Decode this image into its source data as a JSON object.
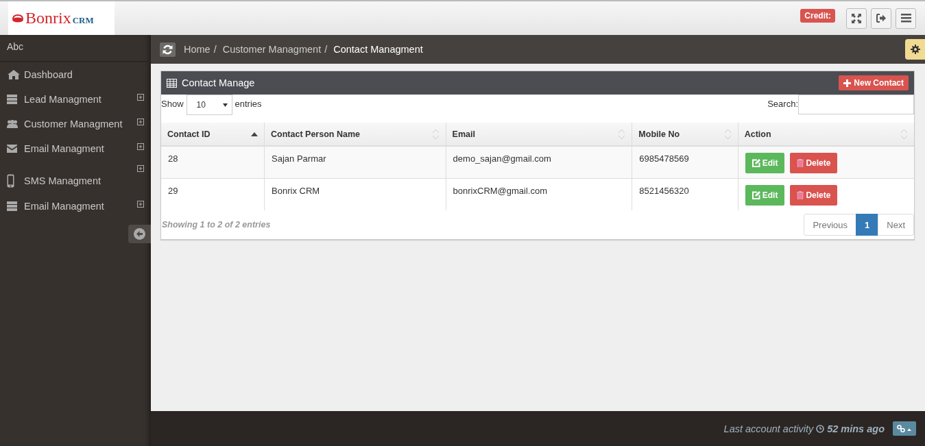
{
  "header": {
    "logo": {
      "brand": "Bonrix",
      "suffix": "CRM"
    },
    "credit": "Credit:"
  },
  "sidebar": {
    "user": "Abc",
    "items": [
      {
        "label": "Dashboard",
        "kind": "home",
        "expandable": false
      },
      {
        "label": "Lead Managment",
        "kind": "server",
        "expandable": true
      },
      {
        "label": "Customer Managment",
        "kind": "users",
        "expandable": true
      },
      {
        "label": "Email Managment",
        "kind": "envelope",
        "expandable": true
      },
      {
        "label": "SMS Managment",
        "kind": "mobile",
        "expandable": true
      },
      {
        "label": "Email Managment",
        "kind": "server",
        "expandable": true
      }
    ]
  },
  "breadcrumb": {
    "separator": "/",
    "items": [
      "Home",
      "Customer Managment",
      "Contact Managment"
    ]
  },
  "panel": {
    "title": "Contact Manage",
    "new_button": "New Contact",
    "show_label": "Show",
    "page_size": "10",
    "entries_label": "entries",
    "search_label": "Search:",
    "table": {
      "columns": [
        {
          "label": "Contact ID",
          "sorted": true
        },
        {
          "label": "Contact Person Name",
          "sorted": false
        },
        {
          "label": "Email",
          "sorted": false
        },
        {
          "label": "Mobile No",
          "sorted": false
        },
        {
          "label": "Action",
          "sorted": false
        }
      ],
      "rows": [
        {
          "id": "28",
          "name": "Sajan Parmar",
          "email": "demo_sajan@gmail.com",
          "mobile": "6985478569",
          "edit": "Edit",
          "delete": "Delete"
        },
        {
          "id": "29",
          "name": "Bonrix CRM",
          "email": "bonrixCRM@gmail.com",
          "mobile": "8521456320",
          "edit": "Edit",
          "delete": "Delete"
        }
      ]
    },
    "info": "Showing 1 to 2 of 2 entries",
    "pagination": [
      {
        "label": "Previous",
        "selected": false
      },
      {
        "label": "1",
        "selected": true
      },
      {
        "label": "Next",
        "selected": false
      }
    ]
  },
  "footer": {
    "activity_label": "Last account activity",
    "activity_time": "52 mins ago"
  }
}
